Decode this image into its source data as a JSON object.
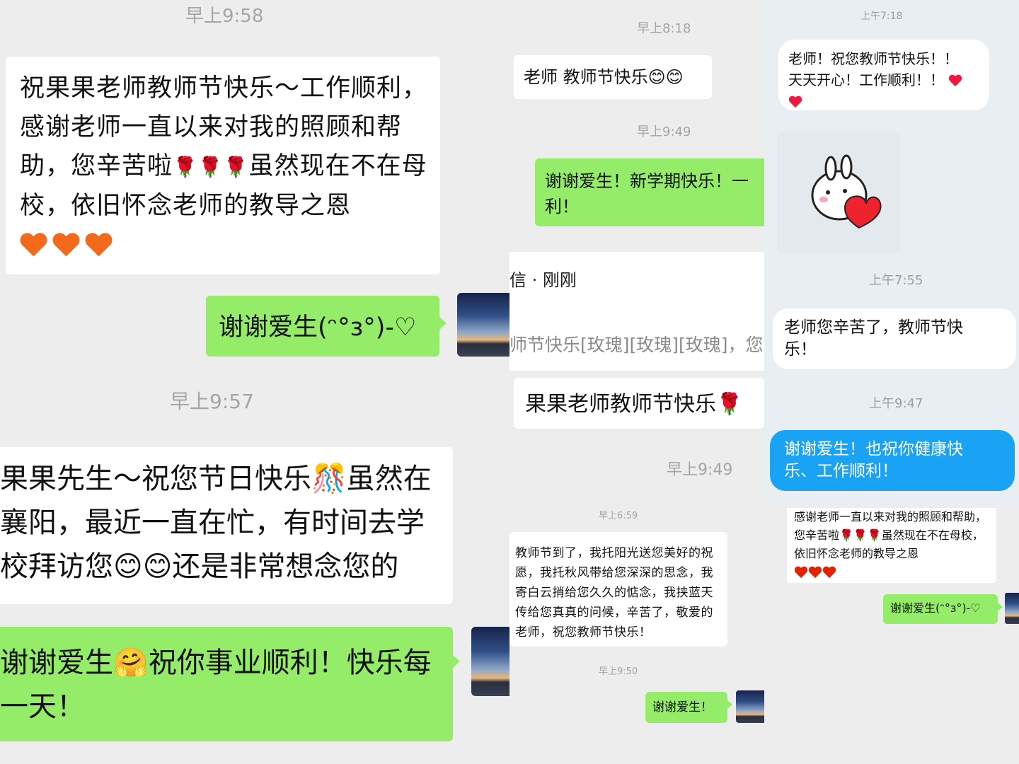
{
  "panel_left": {
    "ts1": "早上9:58",
    "msg1": "祝果果老师教师节快乐～工作顺利，感谢老师一直以来对我的照顾和帮助，您辛苦啦🌹🌹🌹虽然现在不在母校，依旧怀念老师的教导之恩",
    "reply1": "谢谢爱生(ᵔ°з°)-♡",
    "ts2": "早上9:57",
    "msg2_l1": "果果先生～祝您节日快乐🎊虽然在",
    "msg2_l2": "襄阳，最近一直在忙，有时间去学",
    "msg2_l3": "校拜访您😊😊还是非常想念您的",
    "reply2_l1": "谢谢爱生🤗祝你事业顺利！快乐每",
    "reply2_l2": "一天！"
  },
  "panel_mid": {
    "ts1": "早上8:18",
    "msg1": "老师 教师节快乐😊😊",
    "ts2": "早上9:49",
    "reply1_l1": "谢谢爱生！新学期快乐！一",
    "reply1_l2": "利！",
    "notify_title": "信 · 刚刚",
    "notify_body": "师节快乐[玫瑰][玫瑰][玫瑰]，您",
    "msg2": "果果老师教师节快乐🌹",
    "ts3": "早上9:49",
    "ts4": "早上6:59",
    "msg3": "教师节到了，我托阳光送您美好的祝愿，我托秋风带给您深深的思念，我寄白云捎给您久久的惦念，我挟蓝天传给您真真的问候，辛苦了，敬爱的老师，祝您教师节快乐！",
    "ts5": "早上9:50",
    "reply2": "谢谢爱生！"
  },
  "panel_right": {
    "ts1": "上午7:18",
    "msg1_l1": "老师！祝您教师节快乐！！",
    "msg1_l2": "天天开心！工作顺利！！",
    "ts2": "上午7:55",
    "msg2_l1": "老师您辛苦了，教师节快",
    "msg2_l2": "乐！",
    "ts3": "上午9:47",
    "reply1_l1": "谢谢爱生！也祝你健康快",
    "reply1_l2": "乐、工作顺利！",
    "msg3": "感谢老师一直以来对我的照顾和帮助，您辛苦啦🌹🌹🌹虽然现在不在母校，依旧怀念老师的教导之恩",
    "reply2": "谢谢爱生(ᵔ°з°)-♡"
  },
  "colors": {
    "background": "#ededed",
    "bubble_out": "#95ec69",
    "bubble_in": "#ffffff",
    "bubble_blue": "#1aa3f5",
    "timestamp": "#a5a5a5"
  },
  "icons": [
    "heart-emoji",
    "smile-emoji",
    "rose-emoji",
    "sticker-rabbit-heart",
    "avatar-sunset"
  ]
}
